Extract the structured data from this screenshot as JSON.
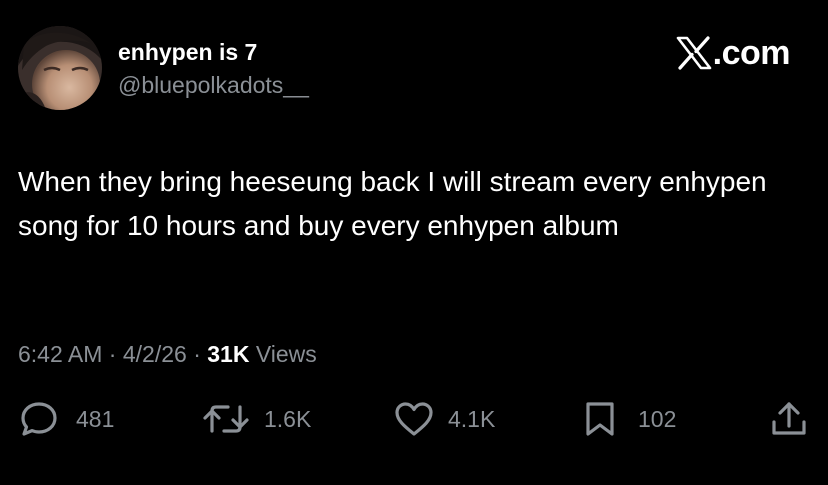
{
  "user": {
    "display_name": "enhypen is 7",
    "handle": "@bluepolkadots__"
  },
  "brand": {
    "text": ".com",
    "icon": "x-logo-icon"
  },
  "tweet": {
    "text": "When they bring heeseung back I will stream every enhypen song for 10 hours and buy every enhypen album"
  },
  "meta": {
    "time": "6:42 AM",
    "separator": "·",
    "date": "4/2/26",
    "views_count": "31K",
    "views_label": "Views"
  },
  "actions": {
    "replies": "481",
    "reposts": "1.6K",
    "likes": "4.1K",
    "bookmarks": "102"
  },
  "colors": {
    "background": "#000000",
    "primary_text": "#ffffff",
    "secondary_text": "#8b9096"
  }
}
